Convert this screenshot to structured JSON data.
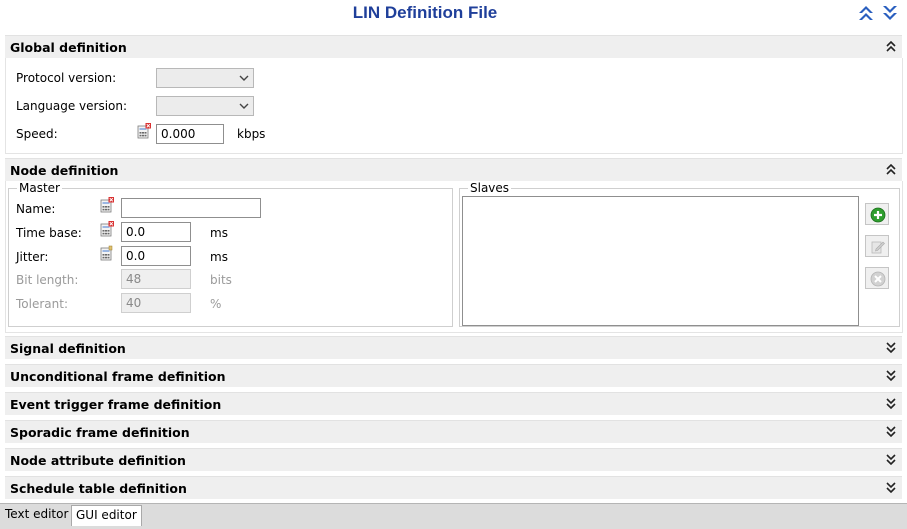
{
  "header": {
    "title": "LIN Definition File",
    "expand_all_icon": "double-chevron-up-icon",
    "collapse_all_icon": "double-chevron-down-icon"
  },
  "global_definition": {
    "title": "Global definition",
    "state": "expanded",
    "protocol_version_label": "Protocol version:",
    "protocol_version_value": "",
    "language_version_label": "Language version:",
    "language_version_value": "",
    "speed_label": "Speed:",
    "speed_value": "0.000",
    "speed_unit": "kbps"
  },
  "node_definition": {
    "title": "Node definition",
    "state": "expanded",
    "master_group_label": "Master",
    "name_label": "Name:",
    "name_value": "",
    "time_base_label": "Time base:",
    "time_base_value": "0.0",
    "time_base_unit": "ms",
    "jitter_label": "Jitter:",
    "jitter_value": "0.0",
    "jitter_unit": "ms",
    "bit_length_label": "Bit length:",
    "bit_length_value": "48",
    "bit_length_unit": "bits",
    "tolerant_label": "Tolerant:",
    "tolerant_value": "40",
    "tolerant_unit": "%",
    "slaves_group_label": "Slaves",
    "add_icon": "add-icon",
    "edit_icon": "edit-icon",
    "delete_icon": "delete-icon"
  },
  "collapsed_sections": [
    "Signal definition",
    "Unconditional frame definition",
    "Event trigger frame definition",
    "Sporadic frame definition",
    "Node attribute definition",
    "Schedule table definition"
  ],
  "tabs": [
    "Text editor",
    "GUI editor"
  ],
  "active_tab": "GUI editor",
  "colors": {
    "title": "#1f3f9a",
    "section_bg": "#efefef",
    "add_green": "#2e9e2e",
    "chevron_blue": "#2a5fbf"
  }
}
